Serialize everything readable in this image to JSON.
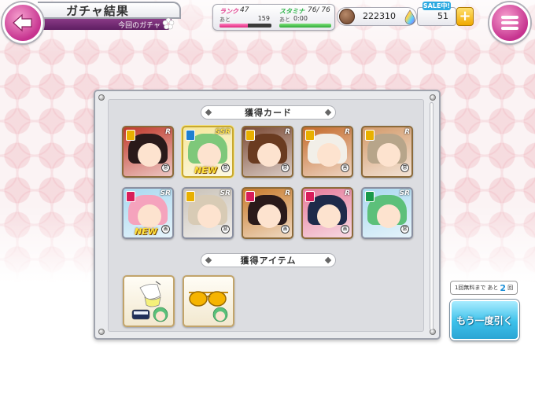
{
  "header": {
    "title": "ガチャ結果",
    "subtitle": "今回のガチャ"
  },
  "stats": {
    "rank_label": "ランク",
    "rank_value": "47",
    "rank_next_label": "あと",
    "rank_next_value": "159",
    "stamina_label": "スタミナ",
    "stamina_value": "76/ 76",
    "stamina_next_label": "あと",
    "stamina_next_value": "0:00",
    "rank_progress": 0.55,
    "stamina_progress": 1.0
  },
  "currency": {
    "coins": "222310",
    "sale_label": "SALE中!",
    "gems": "51",
    "plus_label": "+"
  },
  "cards_section": {
    "header": "獲得カード",
    "cards": [
      {
        "rarity": "R",
        "clan_color": "#e8b000",
        "hair": "#2a1a1a",
        "bg": "#c0392b",
        "is_new": false,
        "element": "悪"
      },
      {
        "rarity": "SSR",
        "clan_color": "#1f7fd0",
        "hair": "#7ec87a",
        "bg": "#f6e79a",
        "is_new": true,
        "element": "悪"
      },
      {
        "rarity": "R",
        "clan_color": "#e8b000",
        "hair": "#6a3b20",
        "bg": "#7b4a34",
        "is_new": false,
        "element": "悪"
      },
      {
        "rarity": "R",
        "clan_color": "#e8b000",
        "hair": "#f2efe8",
        "bg": "#c46a2a",
        "is_new": false,
        "element": "善"
      },
      {
        "rarity": "R",
        "clan_color": "#e8b000",
        "hair": "#b7a58a",
        "bg": "#d39a6a",
        "is_new": false,
        "element": "悪"
      },
      {
        "rarity": "SR",
        "clan_color": "#d81e5b",
        "hair": "#f5a3bd",
        "bg": "#a8d8f0",
        "is_new": true,
        "element": "善"
      },
      {
        "rarity": "SR",
        "clan_color": "#e8b000",
        "hair": "#d8cbb5",
        "bg": "#c9c2b8",
        "is_new": false,
        "element": "悪"
      },
      {
        "rarity": "R",
        "clan_color": "#d81e5b",
        "hair": "#2a1a1a",
        "bg": "#c87a2a",
        "is_new": false,
        "element": "善"
      },
      {
        "rarity": "R",
        "clan_color": "#d81e5b",
        "hair": "#1e2a4a",
        "bg": "#e57a9a",
        "is_new": false,
        "element": "善"
      },
      {
        "rarity": "SR",
        "clan_color": "#1a9a4a",
        "hair": "#5cc07a",
        "bg": "#a8d8f0",
        "is_new": false,
        "element": "悪"
      }
    ]
  },
  "items_section": {
    "header": "獲得アイテム",
    "items": [
      {
        "name": "item-swimsuit"
      },
      {
        "name": "item-sunglasses"
      }
    ]
  },
  "gacha_again": {
    "free_prefix": "1回無料まで",
    "free_mid": "あと",
    "free_count": "2",
    "free_suffix": "回",
    "button_label": "もう一度引く"
  }
}
